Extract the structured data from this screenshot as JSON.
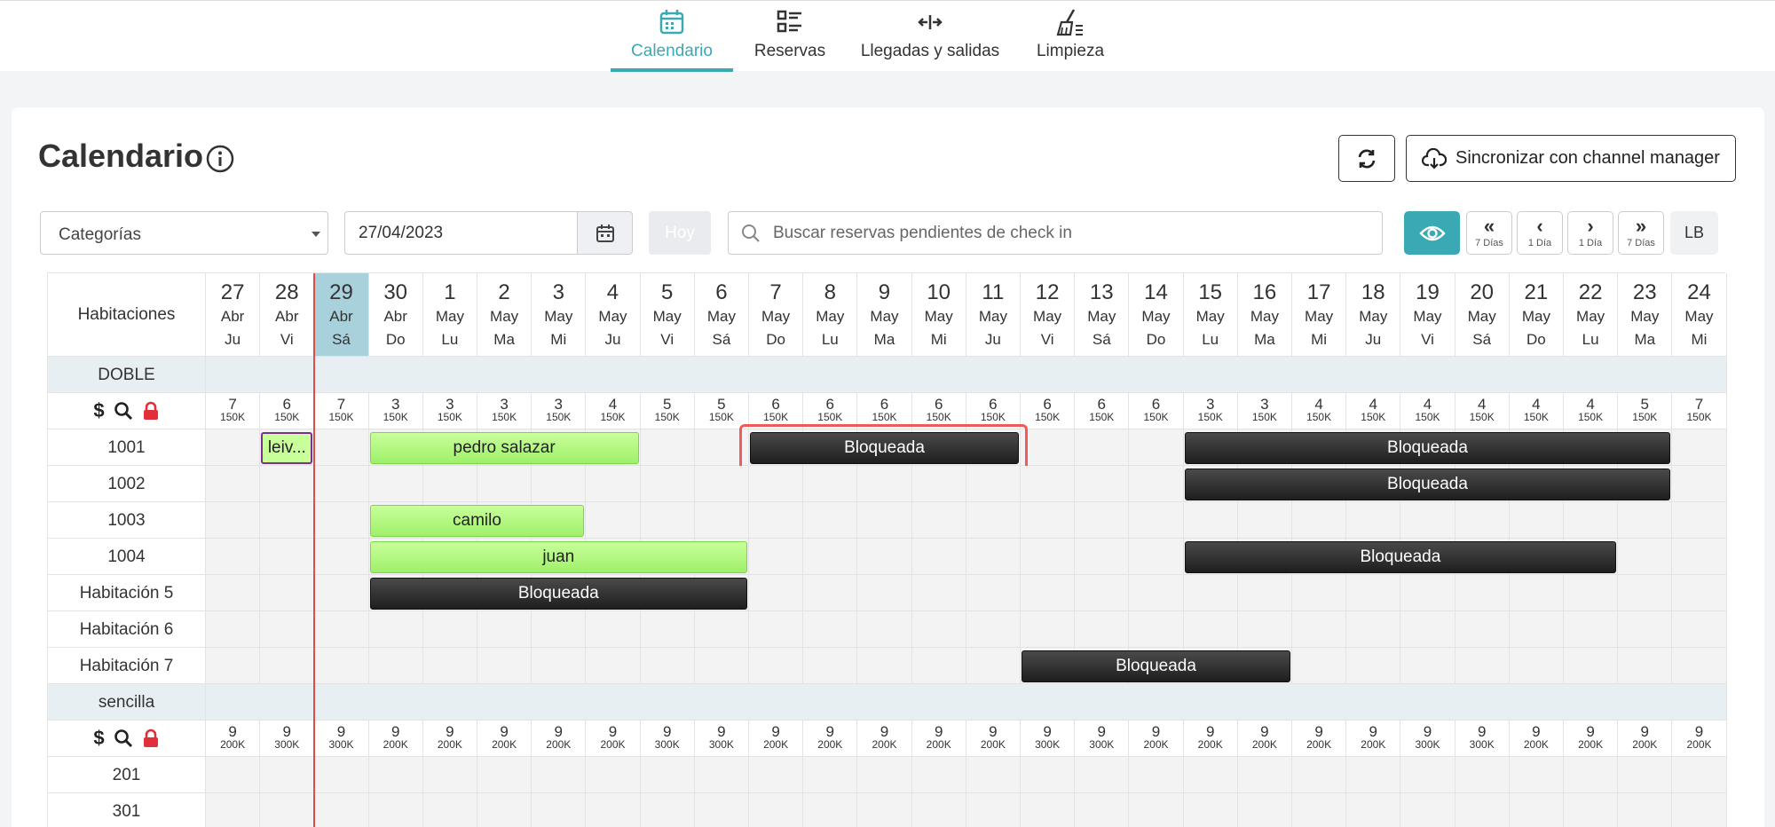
{
  "nav": {
    "tabs": [
      {
        "label": "Calendario",
        "icon": "calendar-icon",
        "active": true
      },
      {
        "label": "Reservas",
        "icon": "list-icon",
        "active": false
      },
      {
        "label": "Llegadas y salidas",
        "icon": "arrows-icon",
        "active": false
      },
      {
        "label": "Limpieza",
        "icon": "broom-icon",
        "active": false
      }
    ]
  },
  "page": {
    "title": "Calendario",
    "sync_label": "Sincronizar con channel manager"
  },
  "filters": {
    "category_value": "Categorías",
    "date_value": "27/04/2023",
    "today_label": "Hoy",
    "search_placeholder": "Buscar reservas pendientes de check in",
    "nav_buttons": [
      {
        "arrow": "«",
        "sub": "7 Días"
      },
      {
        "arrow": "‹",
        "sub": "1 Día"
      },
      {
        "arrow": "›",
        "sub": "1 Día"
      },
      {
        "arrow": "»",
        "sub": "7 Días"
      }
    ],
    "lb_label": "LB"
  },
  "calendar": {
    "header_label": "Habitaciones",
    "today_index": 2,
    "days": [
      {
        "num": "27",
        "mon": "Abr",
        "wd": "Ju"
      },
      {
        "num": "28",
        "mon": "Abr",
        "wd": "Vi"
      },
      {
        "num": "29",
        "mon": "Abr",
        "wd": "Sá"
      },
      {
        "num": "30",
        "mon": "Abr",
        "wd": "Do"
      },
      {
        "num": "1",
        "mon": "May",
        "wd": "Lu"
      },
      {
        "num": "2",
        "mon": "May",
        "wd": "Ma"
      },
      {
        "num": "3",
        "mon": "May",
        "wd": "Mi"
      },
      {
        "num": "4",
        "mon": "May",
        "wd": "Ju"
      },
      {
        "num": "5",
        "mon": "May",
        "wd": "Vi"
      },
      {
        "num": "6",
        "mon": "May",
        "wd": "Sá"
      },
      {
        "num": "7",
        "mon": "May",
        "wd": "Do"
      },
      {
        "num": "8",
        "mon": "May",
        "wd": "Lu"
      },
      {
        "num": "9",
        "mon": "May",
        "wd": "Ma"
      },
      {
        "num": "10",
        "mon": "May",
        "wd": "Mi"
      },
      {
        "num": "11",
        "mon": "May",
        "wd": "Ju"
      },
      {
        "num": "12",
        "mon": "May",
        "wd": "Vi"
      },
      {
        "num": "13",
        "mon": "May",
        "wd": "Sá"
      },
      {
        "num": "14",
        "mon": "May",
        "wd": "Do"
      },
      {
        "num": "15",
        "mon": "May",
        "wd": "Lu"
      },
      {
        "num": "16",
        "mon": "May",
        "wd": "Ma"
      },
      {
        "num": "17",
        "mon": "May",
        "wd": "Mi"
      },
      {
        "num": "18",
        "mon": "May",
        "wd": "Ju"
      },
      {
        "num": "19",
        "mon": "May",
        "wd": "Vi"
      },
      {
        "num": "20",
        "mon": "May",
        "wd": "Sá"
      },
      {
        "num": "21",
        "mon": "May",
        "wd": "Do"
      },
      {
        "num": "22",
        "mon": "May",
        "wd": "Lu"
      },
      {
        "num": "23",
        "mon": "May",
        "wd": "Ma"
      },
      {
        "num": "24",
        "mon": "May",
        "wd": "Mi"
      }
    ],
    "categories": [
      {
        "name": "DOBLE",
        "availability": [
          "7",
          "6",
          "7",
          "3",
          "3",
          "3",
          "3",
          "4",
          "5",
          "5",
          "6",
          "6",
          "6",
          "6",
          "6",
          "6",
          "6",
          "6",
          "3",
          "3",
          "4",
          "4",
          "4",
          "4",
          "4",
          "4",
          "5",
          "7"
        ],
        "prices": [
          "150K",
          "150K",
          "150K",
          "150K",
          "150K",
          "150K",
          "150K",
          "150K",
          "150K",
          "150K",
          "150K",
          "150K",
          "150K",
          "150K",
          "150K",
          "150K",
          "150K",
          "150K",
          "150K",
          "150K",
          "150K",
          "150K",
          "150K",
          "150K",
          "150K",
          "150K",
          "150K",
          "150K"
        ],
        "rooms": [
          {
            "name": "1001",
            "reservations": [
              {
                "label": "leiv...",
                "start": 1,
                "span": 1,
                "style": "purple"
              },
              {
                "label": "pedro salazar",
                "start": 3,
                "span": 5,
                "style": "green"
              },
              {
                "label": "Bloqueada",
                "start": 10,
                "span": 5,
                "style": "black",
                "highlight": true
              },
              {
                "label": "Bloqueada",
                "start": 18,
                "span": 9,
                "style": "black"
              }
            ]
          },
          {
            "name": "1002",
            "reservations": [
              {
                "label": "Bloqueada",
                "start": 18,
                "span": 9,
                "style": "black"
              }
            ]
          },
          {
            "name": "1003",
            "reservations": [
              {
                "label": "camilo",
                "start": 3,
                "span": 4,
                "style": "green"
              }
            ]
          },
          {
            "name": "1004",
            "reservations": [
              {
                "label": "juan",
                "start": 3,
                "span": 7,
                "style": "green"
              },
              {
                "label": "Bloqueada",
                "start": 18,
                "span": 8,
                "style": "black"
              }
            ]
          },
          {
            "name": "Habitación 5",
            "reservations": [
              {
                "label": "Bloqueada",
                "start": 3,
                "span": 7,
                "style": "black"
              }
            ]
          },
          {
            "name": "Habitación 6",
            "reservations": []
          },
          {
            "name": "Habitación 7",
            "reservations": [
              {
                "label": "Bloqueada",
                "start": 15,
                "span": 5,
                "style": "black"
              }
            ]
          }
        ]
      },
      {
        "name": "sencilla",
        "availability": [
          "9",
          "9",
          "9",
          "9",
          "9",
          "9",
          "9",
          "9",
          "9",
          "9",
          "9",
          "9",
          "9",
          "9",
          "9",
          "9",
          "9",
          "9",
          "9",
          "9",
          "9",
          "9",
          "9",
          "9",
          "9",
          "9",
          "9",
          "9"
        ],
        "prices": [
          "200K",
          "300K",
          "300K",
          "200K",
          "200K",
          "200K",
          "200K",
          "200K",
          "300K",
          "300K",
          "200K",
          "200K",
          "200K",
          "200K",
          "200K",
          "300K",
          "300K",
          "200K",
          "200K",
          "200K",
          "200K",
          "200K",
          "300K",
          "300K",
          "200K",
          "200K",
          "200K",
          "200K"
        ],
        "rooms": [
          {
            "name": "201",
            "reservations": []
          },
          {
            "name": "301",
            "reservations": []
          }
        ]
      }
    ]
  },
  "colors": {
    "accent": "#3ba9b3",
    "today_bg": "#a9d1dc",
    "lock": "#e0303a",
    "highlight": "#ef5b5b"
  }
}
